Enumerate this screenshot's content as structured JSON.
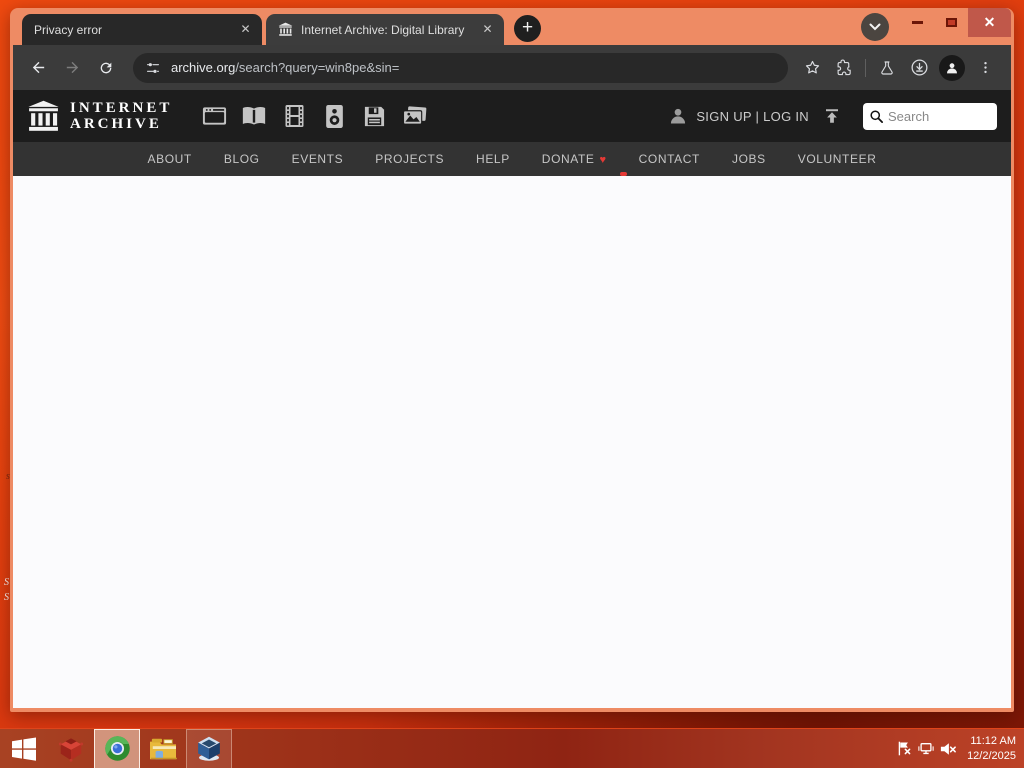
{
  "browser": {
    "tabs": [
      {
        "title": "Privacy error",
        "close_label": "✕"
      },
      {
        "title": "Internet Archive: Digital Library",
        "close_label": "✕"
      }
    ],
    "newtab_label": "+",
    "window_close_label": "✕",
    "url": {
      "domain": "archive.org",
      "path": "/search?query=win8pe&sin="
    }
  },
  "ia": {
    "logo_line1": "INTERNET",
    "logo_line2": "ARCHIVE",
    "auth": "SIGN UP | LOG IN",
    "search_placeholder": "Search",
    "donate_heart": "♥",
    "nav": [
      "ABOUT",
      "BLOG",
      "EVENTS",
      "PROJECTS",
      "HELP",
      "DONATE",
      "CONTACT",
      "JOBS",
      "VOLUNTEER"
    ]
  },
  "taskbar": {
    "clock_time": "11:12 AM",
    "clock_date": "12/2/2025"
  },
  "desktop": {
    "fragments": [
      "s",
      "S",
      "S"
    ]
  },
  "colors": {
    "frame_salmon": "#ee8b64",
    "close_button_red": "#c0584a",
    "desktop_orange": "#e8430f",
    "taskbar_red": "#9c3018",
    "ia_header_black": "#1d1d1d",
    "ia_nav_gray": "#333333",
    "donate_heart_red": "#e53935"
  }
}
